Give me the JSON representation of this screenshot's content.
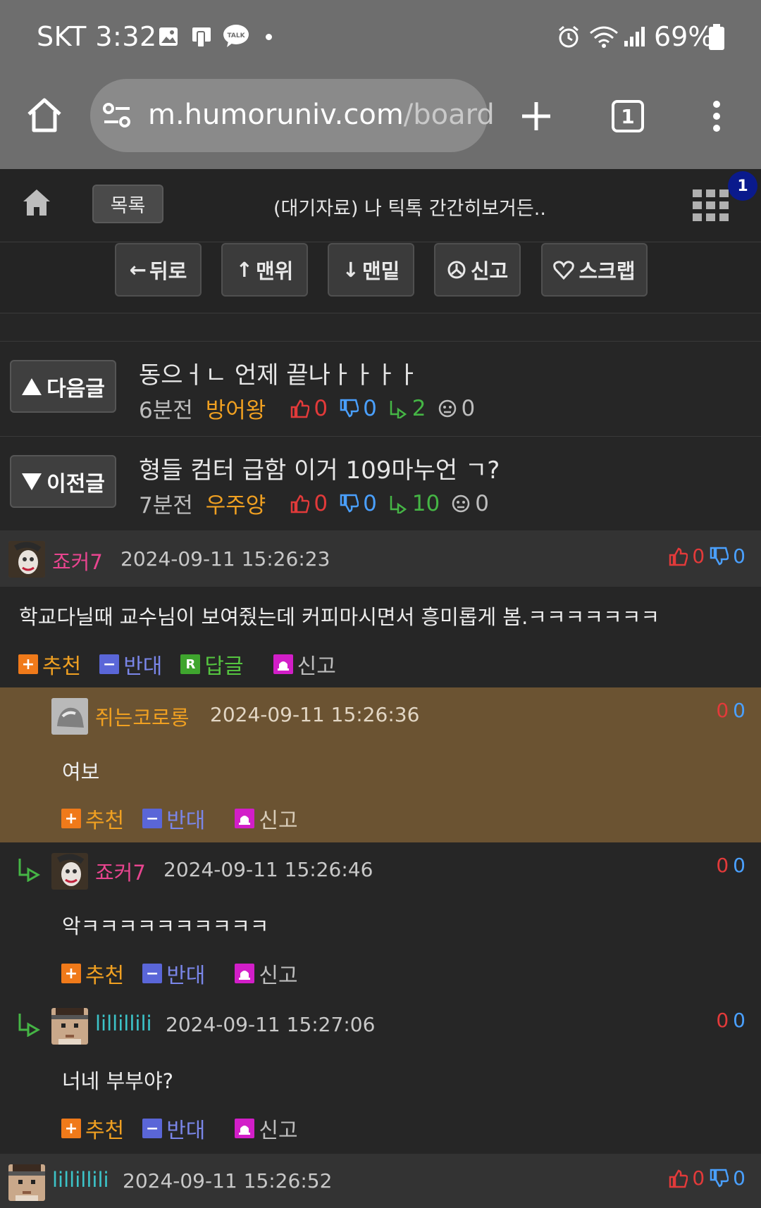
{
  "status": {
    "carrier_time": "SKT 3:32",
    "battery": "69%"
  },
  "browser": {
    "url_main": "m.humoruniv.com",
    "url_rest": "/board",
    "tab_count": "1"
  },
  "header": {
    "list_label": "목록",
    "title": "(대기자료) 나 틱톡 간간히보거든..",
    "badge": "1"
  },
  "toolbar": {
    "back": "뒤로",
    "top": "맨위",
    "bottom": "맨밑",
    "report": "신고",
    "scrap": "스크랩"
  },
  "next_post": {
    "label": "다음글",
    "title": "동으ㅓㄴ 언제 끝나ㅏㅏㅏㅏ",
    "time": "6분전",
    "author": "방어왕",
    "up": "0",
    "down": "0",
    "replies": "2",
    "views": "0"
  },
  "prev_post": {
    "label": "이전글",
    "title": "형들 컴터 급함 이거 109마누언 ㄱ?",
    "time": "7분전",
    "author": "우주양",
    "up": "0",
    "down": "0",
    "replies": "10",
    "views": "0"
  },
  "actions": {
    "recommend": "추천",
    "oppose": "반대",
    "reply": "답글",
    "report": "신고"
  },
  "comments": [
    {
      "name": "죠커7",
      "date": "2024-09-11 15:26:23",
      "text": "학교다닐때 교수님이 보여줬는데 커피마시면서 흥미롭게 봄.ㅋㅋㅋㅋㅋㅋㅋ",
      "up": "0",
      "down": "0"
    },
    {
      "name": "쥐는코로롱",
      "date": "2024-09-11 15:26:36",
      "text": "여보",
      "up": "0",
      "down": "0"
    },
    {
      "name": "죠커7",
      "date": "2024-09-11 15:26:46",
      "text": "악ㅋㅋㅋㅋㅋㅋㅋㅋㅋㅋ",
      "up": "0",
      "down": "0"
    },
    {
      "name": "lillillili",
      "date": "2024-09-11 15:27:06",
      "text": "너네 부부야?",
      "up": "0",
      "down": "0"
    },
    {
      "name": "lillillili",
      "date": "2024-09-11 15:26:52",
      "up": "0",
      "down": "0"
    }
  ],
  "colors": {
    "pink": "#e8458f",
    "orange": "#f0a021",
    "cyan": "#3cc3c8",
    "brown_bg": "#6b5332"
  }
}
